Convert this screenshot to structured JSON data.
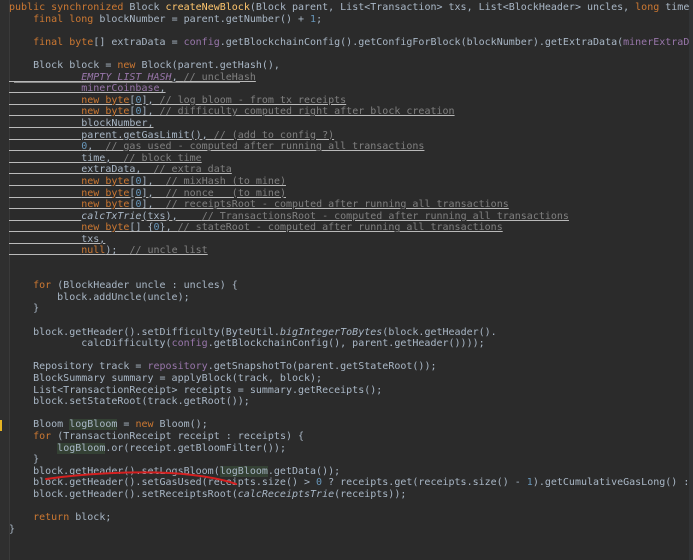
{
  "editor": {
    "colors": {
      "background": "#2b2b2b",
      "keyword": "#cc7832",
      "method": "#ffc66d",
      "number": "#6897bb",
      "field": "#9876aa",
      "comment": "#808080",
      "plain": "#a9b7c6",
      "annotation_red": "#d42020",
      "caret": "#e6b422"
    },
    "lines": [
      [
        [
          "kw",
          "public synchronized "
        ],
        [
          "txt",
          "Block "
        ],
        [
          "fn",
          "createNewBlock"
        ],
        [
          "txt",
          "(Block parent, List<Transaction> txs, List<BlockHeader> uncles, "
        ],
        [
          "kw",
          "long "
        ],
        [
          "txt",
          "time) {"
        ]
      ],
      [
        [
          "txt",
          "    "
        ],
        [
          "kw",
          "final long "
        ],
        [
          "txt",
          "blockNumber = parent.getNumber() + "
        ],
        [
          "num",
          "1"
        ],
        [
          "txt",
          ";"
        ]
      ],
      [],
      [
        [
          "txt",
          "    "
        ],
        [
          "kw",
          "final byte"
        ],
        [
          "txt",
          "[] extraData = "
        ],
        [
          "fld",
          "config"
        ],
        [
          "txt",
          ".getBlockchainConfig().getConfigForBlock(blockNumber).getExtraData("
        ],
        [
          "fld",
          "minerExtraData"
        ],
        [
          "txt",
          ", blockNumber);"
        ]
      ],
      [],
      [
        [
          "txt",
          "    Block block = "
        ],
        [
          "kw",
          "new "
        ],
        [
          "txt",
          "Block(parent.getHash(),"
        ]
      ],
      [
        [
          "txt",
          "            "
        ],
        [
          "sfld",
          "EMPTY_LIST_HASH"
        ],
        [
          "txt",
          ", "
        ],
        [
          "cmt",
          "// uncleHash"
        ]
      ],
      [
        [
          "txt",
          "            "
        ],
        [
          "fld",
          "minerCoinbase"
        ],
        [
          "txt",
          ","
        ]
      ],
      [
        [
          "txt",
          "            "
        ],
        [
          "kw",
          "new byte"
        ],
        [
          "txt",
          "["
        ],
        [
          "num",
          "0"
        ],
        [
          "txt",
          "], "
        ],
        [
          "cmt",
          "// log bloom - from tx receipts"
        ]
      ],
      [
        [
          "txt",
          "            "
        ],
        [
          "kw",
          "new byte"
        ],
        [
          "txt",
          "["
        ],
        [
          "num",
          "0"
        ],
        [
          "txt",
          "], "
        ],
        [
          "cmt",
          "// difficulty computed right after block creation"
        ]
      ],
      [
        [
          "txt",
          "            blockNumber,"
        ]
      ],
      [
        [
          "txt",
          "            parent.getGasLimit(), "
        ],
        [
          "cmt",
          "// (add to config ?)"
        ]
      ],
      [
        [
          "txt",
          "            "
        ],
        [
          "num",
          "0"
        ],
        [
          "txt",
          ",  "
        ],
        [
          "cmt",
          "// gas used - computed after running all transactions"
        ]
      ],
      [
        [
          "txt",
          "            time,  "
        ],
        [
          "cmt",
          "// block time"
        ]
      ],
      [
        [
          "txt",
          "            extraData,  "
        ],
        [
          "cmt",
          "// extra data"
        ]
      ],
      [
        [
          "txt",
          "            "
        ],
        [
          "kw",
          "new byte"
        ],
        [
          "txt",
          "["
        ],
        [
          "num",
          "0"
        ],
        [
          "txt",
          "],  "
        ],
        [
          "cmt",
          "// mixHash (to mine)"
        ]
      ],
      [
        [
          "txt",
          "            "
        ],
        [
          "kw",
          "new byte"
        ],
        [
          "txt",
          "["
        ],
        [
          "num",
          "0"
        ],
        [
          "txt",
          "],  "
        ],
        [
          "cmt",
          "// nonce   (to mine)"
        ]
      ],
      [
        [
          "txt",
          "            "
        ],
        [
          "kw",
          "new byte"
        ],
        [
          "txt",
          "["
        ],
        [
          "num",
          "0"
        ],
        [
          "txt",
          "],  "
        ],
        [
          "cmt",
          "// receiptsRoot - computed after running all transactions"
        ]
      ],
      [
        [
          "txt",
          "            "
        ],
        [
          "it",
          "calcTxTrie"
        ],
        [
          "txt",
          "(txs),    "
        ],
        [
          "cmt",
          "// TransactionsRoot - computed after running all transactions"
        ]
      ],
      [
        [
          "txt",
          "            "
        ],
        [
          "kw",
          "new byte"
        ],
        [
          "txt",
          "[] {"
        ],
        [
          "num",
          "0"
        ],
        [
          "txt",
          "}, "
        ],
        [
          "cmt",
          "// stateRoot - computed after running all transactions"
        ]
      ],
      [
        [
          "txt",
          "            txs,"
        ]
      ],
      [
        [
          "txt",
          "            "
        ],
        [
          "kw",
          "null"
        ],
        [
          "txt",
          ");  "
        ],
        [
          "cmt",
          "// uncle list"
        ]
      ],
      [],
      [],
      [
        [
          "txt",
          "    "
        ],
        [
          "kw",
          "for "
        ],
        [
          "txt",
          "(BlockHeader uncle : uncles) {"
        ]
      ],
      [
        [
          "txt",
          "        block.addUncle(uncle);"
        ]
      ],
      [
        [
          "txt",
          "    }"
        ]
      ],
      [],
      [
        [
          "txt",
          "    block.getHeader().setDifficulty(ByteUtil."
        ],
        [
          "it",
          "bigIntegerToBytes"
        ],
        [
          "txt",
          "(block.getHeader()."
        ]
      ],
      [
        [
          "txt",
          "            calcDifficulty("
        ],
        [
          "fld",
          "config"
        ],
        [
          "txt",
          ".getBlockchainConfig(), parent.getHeader())));"
        ]
      ],
      [],
      [
        [
          "txt",
          "    Repository track = "
        ],
        [
          "fld",
          "repository"
        ],
        [
          "txt",
          ".getSnapshotTo(parent.getStateRoot());"
        ]
      ],
      [
        [
          "txt",
          "    BlockSummary summary = applyBlock(track, block);"
        ]
      ],
      [
        [
          "txt",
          "    List<TransactionReceipt> receipts = summary.getReceipts();"
        ]
      ],
      [
        [
          "txt",
          "    block.setStateRoot(track.getRoot());"
        ]
      ],
      [],
      [
        [
          "txt",
          "    Bloom "
        ],
        [
          "hl",
          "logBloom"
        ],
        [
          "txt",
          " = "
        ],
        [
          "kw",
          "new "
        ],
        [
          "txt",
          "Bloom();"
        ]
      ],
      [
        [
          "txt",
          "    "
        ],
        [
          "kw",
          "for "
        ],
        [
          "txt",
          "(TransactionReceipt receipt : receipts) {"
        ]
      ],
      [
        [
          "txt",
          "        "
        ],
        [
          "hl",
          "logBloom"
        ],
        [
          "txt",
          ".or(receipt.getBloomFilter());"
        ]
      ],
      [
        [
          "txt",
          "    }"
        ]
      ],
      [
        [
          "txt",
          "    block.getHeader().setLogsBloom("
        ],
        [
          "hl",
          "logBloom"
        ],
        [
          "txt",
          ".getData());"
        ]
      ],
      [
        [
          "txt",
          "    block.getHeader().setGasUsed(receipts.size() > "
        ],
        [
          "num",
          "0 "
        ],
        [
          "txt",
          "? receipts.get(receipts.size() - "
        ],
        [
          "num",
          "1"
        ],
        [
          "txt",
          ").getCumulativeGasLong() : "
        ],
        [
          "num",
          "0"
        ],
        [
          "txt",
          ");"
        ]
      ],
      [
        [
          "txt",
          "    block.getHeader().setReceiptsRoot("
        ],
        [
          "it",
          "calcReceiptsTrie"
        ],
        [
          "txt",
          "(receipts));"
        ]
      ],
      [],
      [
        [
          "txt",
          "    "
        ],
        [
          "kw",
          "return "
        ],
        [
          "txt",
          "block;"
        ]
      ],
      [
        [
          "txt",
          "}"
        ]
      ]
    ]
  }
}
